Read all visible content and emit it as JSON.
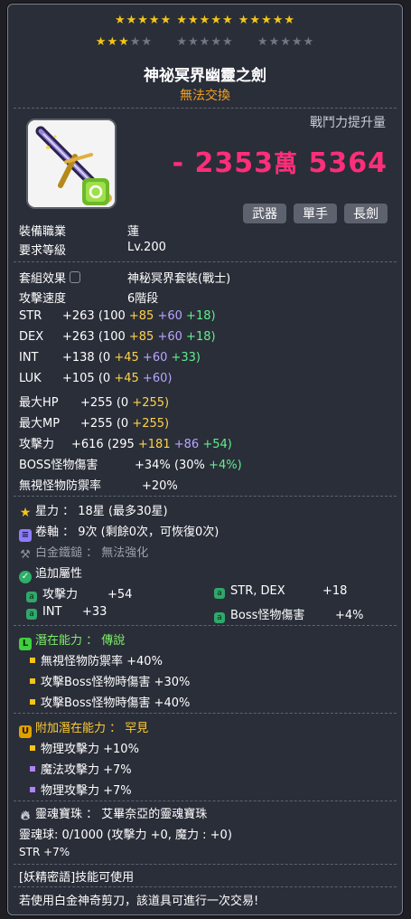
{
  "stars": {
    "row1": "★★★★★ ★★★★★ ★★★★★",
    "row2_filled": "★★★",
    "row2_empty_a": "★★",
    "row2_empty_b": "★★★★★",
    "row2_empty_c": "★★★★★"
  },
  "item": {
    "name": "神祕冥界幽靈之劍",
    "trade": "無法交換"
  },
  "combat_power": {
    "label": "戰鬥力提升量",
    "prefix": "- 2353",
    "wan": "萬",
    "suffix": "5364"
  },
  "tags": [
    "武器",
    "單手",
    "長劍"
  ],
  "requirements": {
    "job_label": "裝備職業",
    "job_value": "蓮",
    "level_label": "要求等級",
    "level_value": "Lv.200"
  },
  "set": {
    "label": "套組效果",
    "value": "神秘冥界套裝(戰士)"
  },
  "speed": {
    "label": "攻擊速度",
    "value": "6階段"
  },
  "stats": [
    {
      "name": "STR",
      "total": "+263",
      "base": "(100",
      "a": "+85",
      "b": "+60",
      "c": "+18)"
    },
    {
      "name": "DEX",
      "total": "+263",
      "base": "(100",
      "a": "+85",
      "b": "+60",
      "c": "+18)"
    },
    {
      "name": "INT",
      "total": "+138",
      "base": "(0",
      "a": "+45",
      "b": "+60",
      "c": "+33)"
    },
    {
      "name": "LUK",
      "total": "+105",
      "base": "(0",
      "a": "+45",
      "b": "+60)",
      "c": ""
    },
    {
      "name": "最大HP",
      "total": "+255",
      "base": "(0",
      "a": "+255)",
      "b": "",
      "c": ""
    },
    {
      "name": "最大MP",
      "total": "+255",
      "base": "(0",
      "a": "+255)",
      "b": "",
      "c": ""
    },
    {
      "name": "攻擊力",
      "total": "+616",
      "base": "(295",
      "a": "+181",
      "b": "+86",
      "c": "+54)"
    },
    {
      "name": "BOSS怪物傷害",
      "total": "+34%",
      "base": "(30%",
      "a": "",
      "b": "",
      "c": "+4%)"
    }
  ],
  "ignore_def": {
    "label": "無視怪物防禦率",
    "value": "+20%"
  },
  "starforce": {
    "label": "星力 ： 18星 (最多30星)"
  },
  "scroll": {
    "label": "卷軸 ： 9次 (剩餘0次，可恢復0次)"
  },
  "hammer": {
    "label": "白金鐵鎚 ： 無法強化"
  },
  "additional": {
    "title": "追加屬性",
    "items": [
      {
        "name": "攻擊力",
        "value": "+54"
      },
      {
        "name": "STR, DEX",
        "value": "+18"
      },
      {
        "name": "INT",
        "value": "+33"
      },
      {
        "name": "Boss怪物傷害",
        "value": "+4%"
      }
    ]
  },
  "potential": {
    "title": "潛在能力 ： 傳說",
    "lines": [
      "無視怪物防禦率 +40%",
      "攻擊Boss怪物時傷害 +30%",
      "攻擊Boss怪物時傷害 +40%"
    ]
  },
  "bonus_potential": {
    "title": "附加潛在能力 ： 罕見",
    "lines": [
      "物理攻擊力 +10%",
      "魔法攻擊力 +7%",
      "物理攻擊力 +7%"
    ]
  },
  "soul": {
    "title": "靈魂寶珠 ： 艾畢奈亞的靈魂寶珠",
    "count": "靈魂球:  0/1000 (攻擊力 +0, 魔力 : +0)",
    "stat": "STR +7%"
  },
  "skill_note": "[妖精密語]技能可使用",
  "scissors_note": "若使用白金神奇剪刀，該道具可進行一次交易!",
  "colors": {
    "combat_power": "#ff2e7a",
    "trade": "#f0a020",
    "stat_yellow": "#ffd24a",
    "stat_purple": "#b8a6ff",
    "stat_green": "#5ff08a"
  }
}
